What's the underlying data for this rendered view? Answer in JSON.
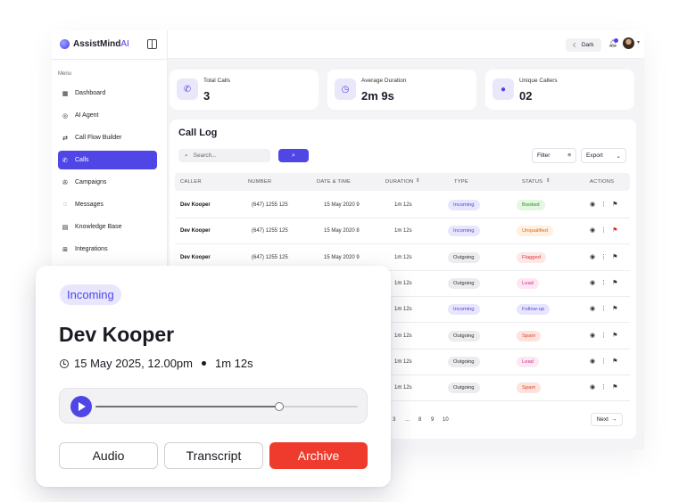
{
  "brand": {
    "name_main": "AssistMind",
    "name_accent": "AI"
  },
  "sidebar": {
    "menu_label": "Menu",
    "items": [
      {
        "label": "Dashboard",
        "icon": "grid-icon"
      },
      {
        "label": "AI Agent",
        "icon": "target-icon"
      },
      {
        "label": "Call Flow Builder",
        "icon": "flow-icon"
      },
      {
        "label": "Calls",
        "icon": "phone-icon",
        "active": true
      },
      {
        "label": "Campaigns",
        "icon": "megaphone-icon"
      },
      {
        "label": "Messages",
        "icon": "chat-icon"
      },
      {
        "label": "Knowledge Base",
        "icon": "book-icon"
      },
      {
        "label": "Integrations",
        "icon": "plug-icon"
      }
    ]
  },
  "topbar": {
    "theme_label": "Dark"
  },
  "stats": [
    {
      "label": "Total Calls",
      "value": "3",
      "icon": "phone-icon"
    },
    {
      "label": "Average Duration",
      "value": "2m 9s",
      "icon": "clock-icon"
    },
    {
      "label": "Unique Callers",
      "value": "02",
      "icon": "user-icon"
    }
  ],
  "call_log": {
    "title": "Call Log",
    "search_placeholder": "Search...",
    "filter_label": "Filter",
    "export_label": "Export",
    "columns": [
      "CALLER",
      "NUMBER",
      "DATE & TIME",
      "DURATION",
      "TYPE",
      "STATUS",
      "ACTIONS"
    ],
    "rows": [
      {
        "caller": "Dev Kooper",
        "number": "(647) 1255 125",
        "date": "15 May 2020 9",
        "duration": "1m 12s",
        "type": "Incoming",
        "status": "Booked"
      },
      {
        "caller": "Dev Kooper",
        "number": "(647) 1255 125",
        "date": "15 May 2020 8",
        "duration": "1m 12s",
        "type": "Incoming",
        "status": "Unqualified"
      },
      {
        "caller": "Dev Kooper",
        "number": "(647) 1255 125",
        "date": "15 May 2020 9",
        "duration": "1m 12s",
        "type": "Outgoing",
        "status": "Flagged"
      },
      {
        "caller": "",
        "number": "",
        "date": "",
        "duration": "1m 12s",
        "type": "Outgoing",
        "status": "Lead"
      },
      {
        "caller": "",
        "number": "",
        "date": "",
        "duration": "1m 12s",
        "type": "Incoming",
        "status": "Follow-up"
      },
      {
        "caller": "",
        "number": "",
        "date": "",
        "duration": "1m 12s",
        "type": "Outgoing",
        "status": "Spam"
      },
      {
        "caller": "",
        "number": "",
        "date": "",
        "duration": "1m 12s",
        "type": "Outgoing",
        "status": "Lead"
      },
      {
        "caller": "",
        "number": "",
        "date": "",
        "duration": "1m 12s",
        "type": "Outgoing",
        "status": "Spam"
      }
    ],
    "pages": [
      "3",
      "...",
      "8",
      "9",
      "10"
    ],
    "next_label": "Next"
  },
  "detail_card": {
    "badge": "Incoming",
    "caller": "Dev Kooper",
    "datetime": "15 May 2025, 12.00pm",
    "duration": "1m 12s",
    "progress": 0.7,
    "buttons": {
      "audio": "Audio",
      "transcript": "Transcript",
      "archive": "Archive"
    }
  },
  "colors": {
    "accent": "#4f46e5",
    "danger": "#ef3b2d"
  }
}
